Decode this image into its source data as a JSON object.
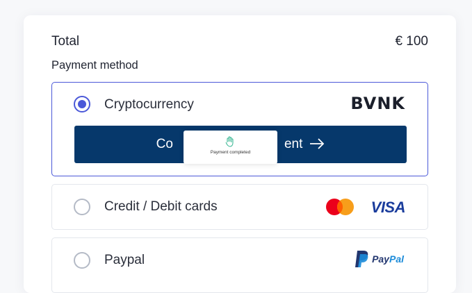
{
  "total": {
    "label": "Total",
    "value": "€ 100"
  },
  "payment_method": {
    "label": "Payment method"
  },
  "options": [
    {
      "label": "Cryptocurrency",
      "selected": true,
      "logo": "BVNK",
      "button": {
        "label_left": "Co",
        "label_right": "ent",
        "icon": "arrow-right-icon"
      }
    },
    {
      "label": "Credit / Debit cards",
      "selected": false,
      "logos": [
        "mastercard-logo",
        "visa-logo"
      ],
      "visa_text": "VISA"
    },
    {
      "label": "Paypal",
      "selected": false,
      "logo_text_a": "Pay",
      "logo_text_b": "Pal"
    }
  ],
  "toast": {
    "text": "Payment completed",
    "icon": "hand-icon"
  },
  "colors": {
    "accent": "#4a58d8",
    "button_bg": "#06386b",
    "visa": "#1a3c9c",
    "mc_red": "#eb001b",
    "mc_orange": "#f79e1b"
  }
}
